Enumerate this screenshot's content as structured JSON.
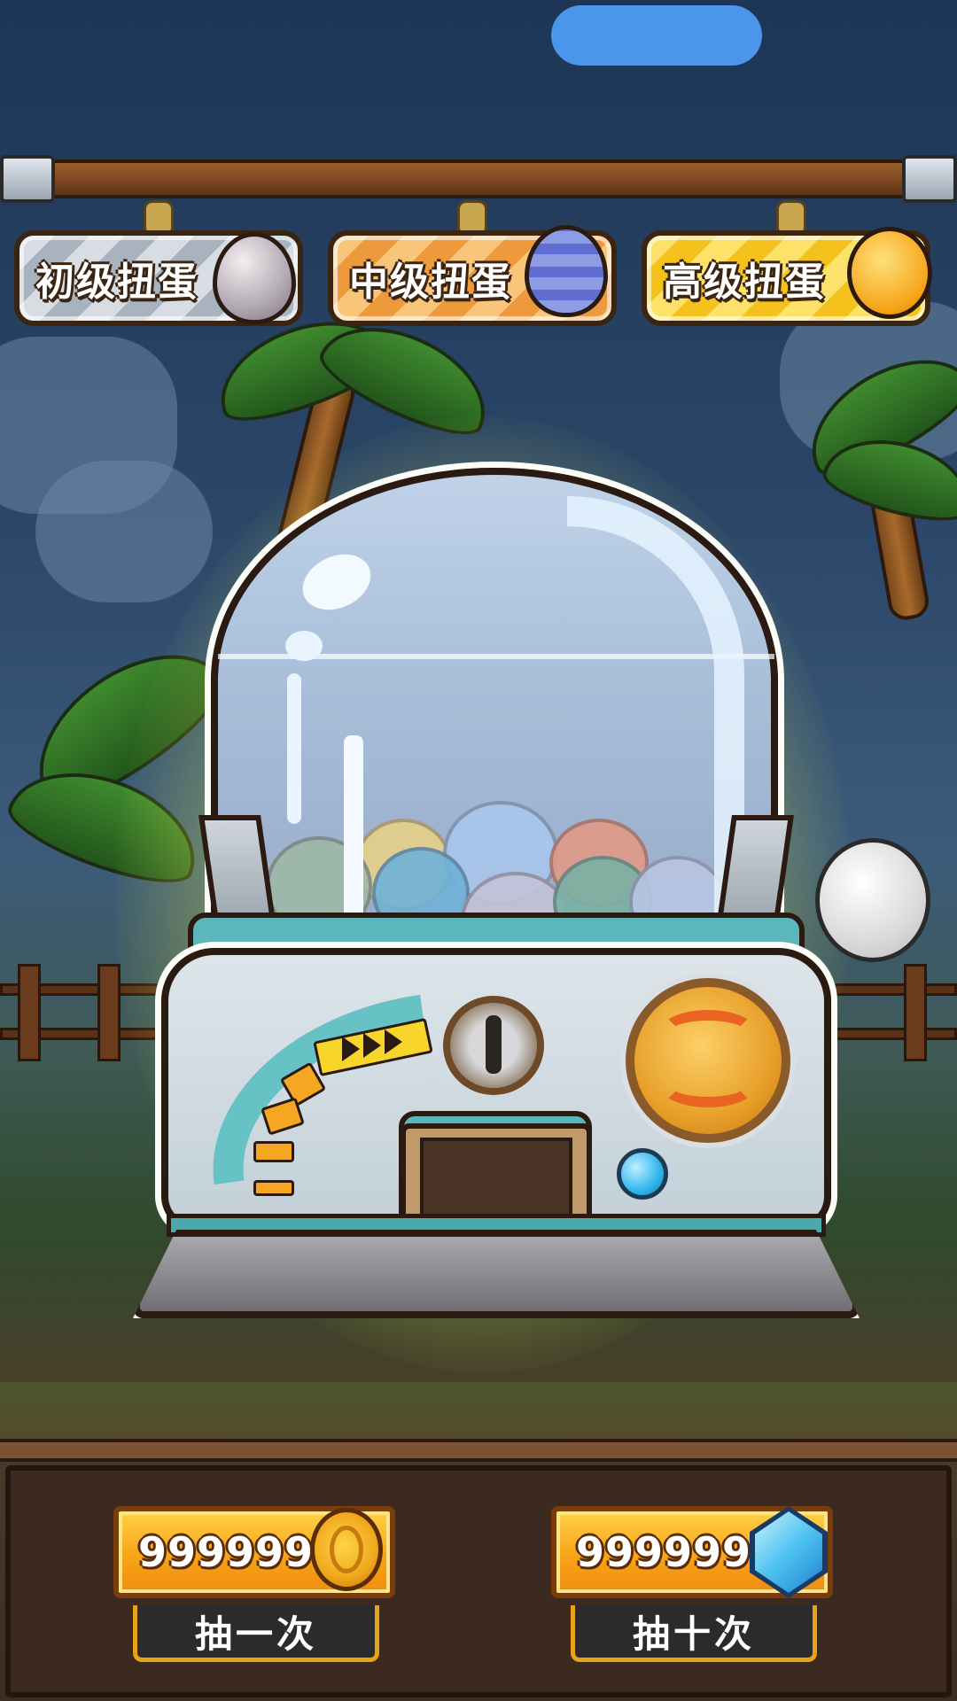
{
  "tabs": [
    {
      "label": "初级扭蛋",
      "egg_icon": "gray-stone-egg-icon"
    },
    {
      "label": "中级扭蛋",
      "egg_icon": "purple-striped-egg-icon"
    },
    {
      "label": "高级扭蛋",
      "egg_icon": "golden-star-egg-icon"
    }
  ],
  "machine": {
    "knob_icon": "orange-rotate-knob-icon",
    "coin_slot_icon": "coin-slot-icon",
    "capsule_colors": [
      "#e7d08a",
      "#a9c6ec",
      "#e19a86",
      "#6fb2d8",
      "#c4c2d8",
      "#7ab2a6",
      "#9fb8a8",
      "#b8c6e4"
    ]
  },
  "actions": {
    "single": {
      "cost": "999999",
      "currency_icon": "gold-coin-icon",
      "label": "抽一次"
    },
    "ten": {
      "cost": "999999",
      "currency_icon": "blue-gem-icon",
      "label": "抽十次"
    }
  },
  "colors": {
    "sky": "#1e3655",
    "accent_orange": "#f8a418",
    "button_dark": "#2c2a2a",
    "glow": "#ebf078"
  }
}
